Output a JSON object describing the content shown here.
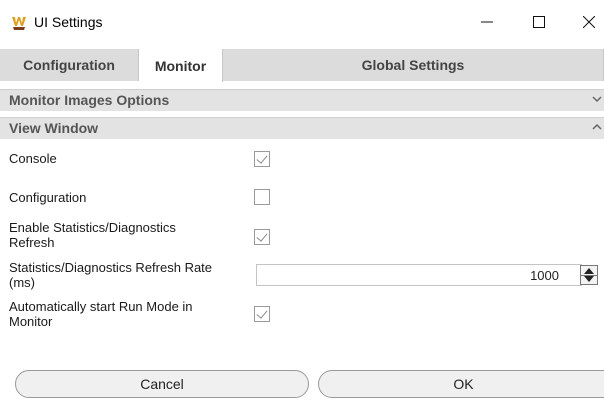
{
  "window": {
    "title": "UI Settings",
    "icon": "app-logo-icon",
    "controls": [
      "minimize-icon",
      "maximize-icon",
      "close-icon"
    ]
  },
  "tabs": [
    {
      "label": "Configuration",
      "selected": false
    },
    {
      "label": "Monitor",
      "selected": true
    },
    {
      "label": "Global Settings",
      "selected": false
    }
  ],
  "sections": {
    "monitor_images": {
      "label": "Monitor Images Options",
      "expanded": false
    },
    "view_window": {
      "label": "View Window",
      "expanded": true
    }
  },
  "options": {
    "console": {
      "label": "Console",
      "checked": true
    },
    "configuration": {
      "label": "Configuration",
      "checked": false
    },
    "stats_refresh": {
      "label_line1": "Enable Statistics/Diagnostics",
      "label_line2": "Refresh",
      "checked": true
    },
    "refresh_rate": {
      "label_line1": "Statistics/Diagnostics Refresh Rate",
      "label_line2": "(ms)",
      "value": "1000"
    },
    "auto_run": {
      "label_line1": "Automatically start Run Mode in",
      "label_line2": "Monitor",
      "checked": true
    }
  },
  "buttons": {
    "cancel": "Cancel",
    "ok": "OK"
  },
  "colors": {
    "tab_bg": "#dcdcdc",
    "section_bg": "#e3e3e3",
    "button_bg": "#f0f0f0"
  }
}
